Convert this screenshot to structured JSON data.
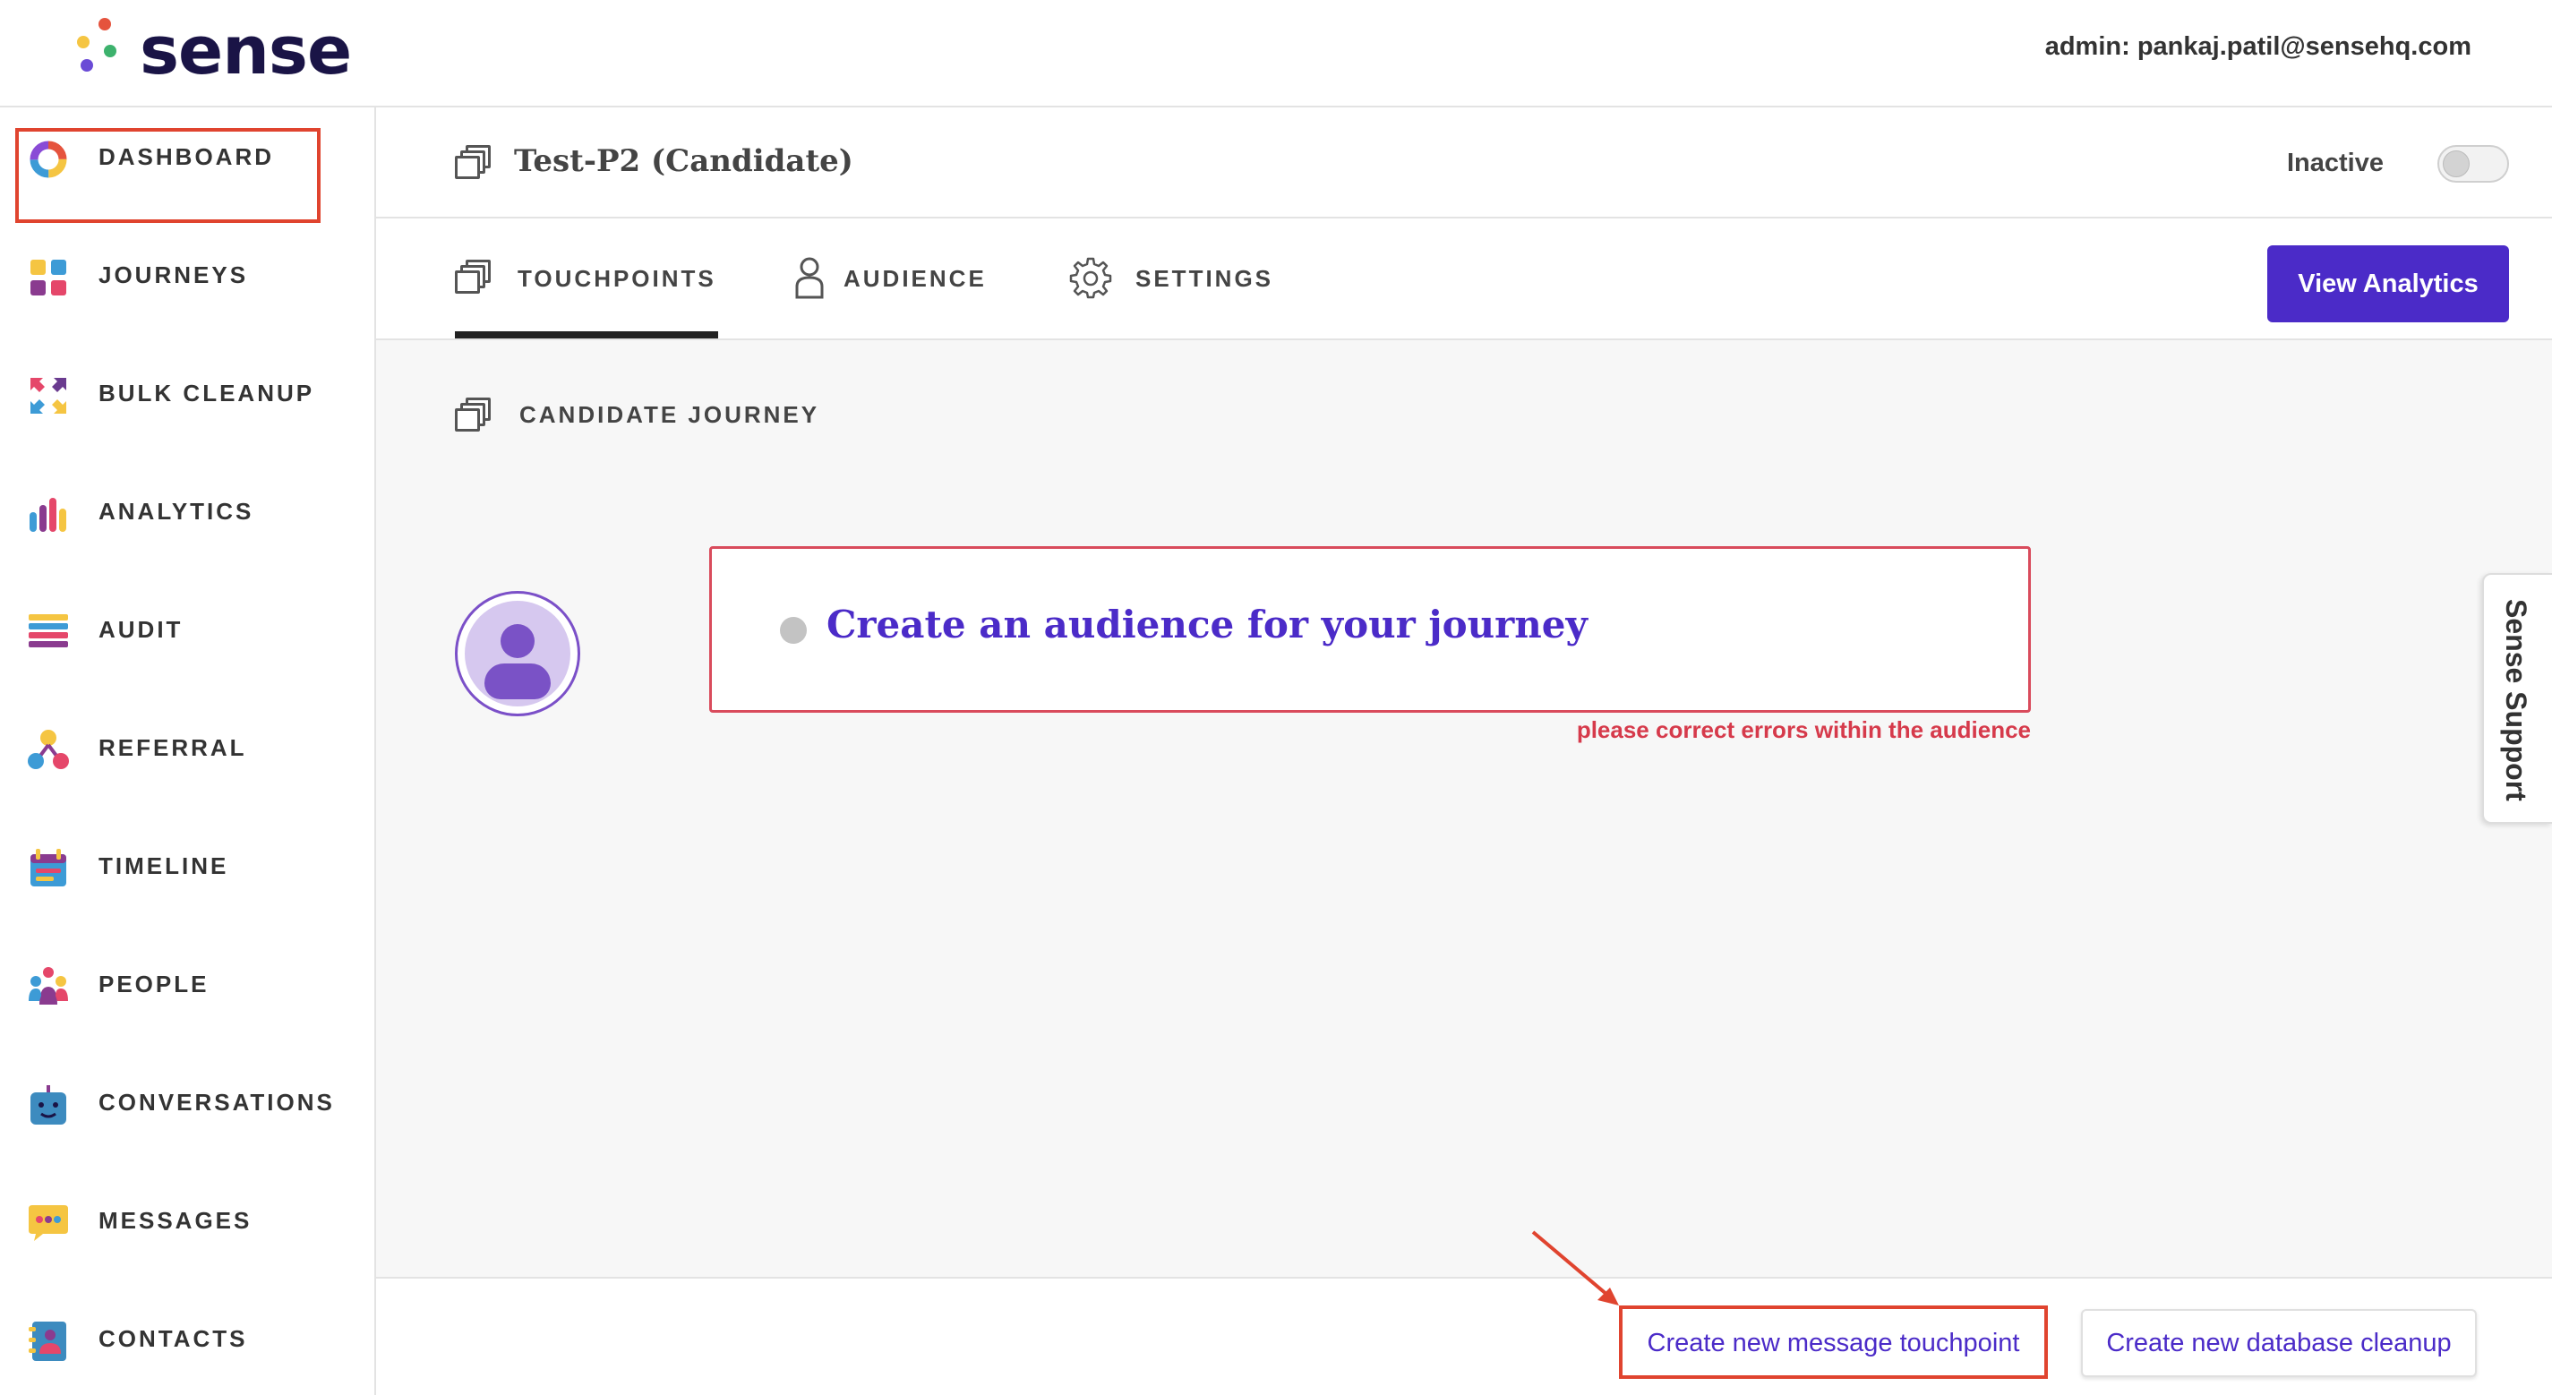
{
  "app": {
    "logo_text": "sense",
    "admin_label": "admin: pankaj.patil@sensehq.com"
  },
  "sidebar": {
    "items": [
      {
        "label": "DASHBOARD",
        "icon": "dashboard-donut-icon"
      },
      {
        "label": "JOURNEYS",
        "icon": "journeys-squares-icon",
        "highlighted": true
      },
      {
        "label": "BULK CLEANUP",
        "icon": "bulk-cleanup-arrows-icon"
      },
      {
        "label": "ANALYTICS",
        "icon": "analytics-bars-icon"
      },
      {
        "label": "AUDIT",
        "icon": "audit-list-icon"
      },
      {
        "label": "REFERRAL",
        "icon": "referral-network-icon"
      },
      {
        "label": "TIMELINE",
        "icon": "timeline-calendar-icon"
      },
      {
        "label": "PEOPLE",
        "icon": "people-group-icon"
      },
      {
        "label": "CONVERSATIONS",
        "icon": "conversations-bot-icon"
      },
      {
        "label": "MESSAGES",
        "icon": "messages-bubble-icon"
      },
      {
        "label": "CONTACTS",
        "icon": "contacts-book-icon"
      }
    ]
  },
  "journey": {
    "title": "Test-P2 (Candidate)",
    "status_label": "Inactive",
    "active": false
  },
  "tabs": [
    {
      "label": "TOUCHPOINTS",
      "icon": "touchpoints-stack-icon",
      "active": true
    },
    {
      "label": "AUDIENCE",
      "icon": "audience-person-icon",
      "active": false
    },
    {
      "label": "SETTINGS",
      "icon": "settings-gear-icon",
      "active": false
    }
  ],
  "toolbar": {
    "view_analytics_label": "View Analytics"
  },
  "content": {
    "section_title": "CANDIDATE JOURNEY",
    "audience_card_text": "Create an audience for your journey",
    "audience_error": "please correct errors within the audience"
  },
  "support": {
    "label": "Sense Support"
  },
  "footer": {
    "create_message_label": "Create new message touchpoint",
    "create_cleanup_label": "Create new database cleanup"
  },
  "colors": {
    "brand_purple": "#4b2bc8",
    "error_red": "#d63a4b",
    "highlight_red": "#e0442f"
  }
}
